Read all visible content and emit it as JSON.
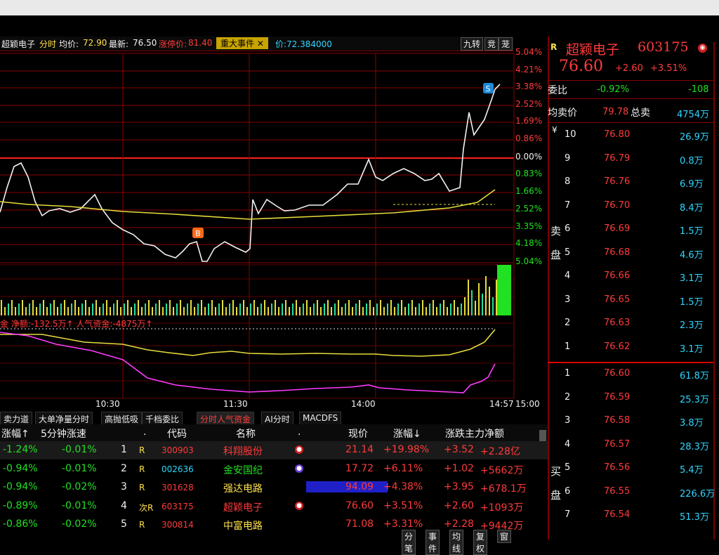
{
  "header": {
    "stock": "超颖电子",
    "mode": "分时",
    "avg_label": "均价:",
    "avg_value": "72.90",
    "latest_label": "最新:",
    "latest_value": "76.50",
    "limit_label": "涨停价:",
    "limit_value": "81.40",
    "event_label": "重大事件",
    "extra": "价:72.384000",
    "buttons": [
      "九转",
      "竞",
      "茏"
    ]
  },
  "right_axis": [
    "5.04%",
    "4.21%",
    "3.38%",
    "2.52%",
    "1.69%",
    "0.86%",
    "0.00%",
    "0.83%",
    "1.66%",
    "2.52%",
    "3.35%",
    "4.18%",
    "5.04%"
  ],
  "fund_label": "金 净额:-132.5万↑ 人气资金:-4875万↑",
  "time_axis": [
    "10:30",
    "11:30",
    "14:00",
    "14:57",
    "15:00"
  ],
  "markers": {
    "buy": "B",
    "sell": "S"
  },
  "quote": {
    "marker": "R",
    "name": "超颖电子",
    "code": "603175",
    "price": "76.60",
    "change": "+2.60",
    "pct": "+3.51%",
    "weibi_label": "委比",
    "weibi_value": "-0.92%",
    "weibi_diff": "-108",
    "avgsell_label": "均卖价",
    "avgsell_value": "79.78",
    "total_sell_label": "总卖",
    "total_sell_value": "4754万"
  },
  "orderbook": {
    "sell_side_label": [
      "卖",
      "盘"
    ],
    "buy_side_label": [
      "买",
      "盘"
    ],
    "yen": "¥",
    "asks": [
      {
        "level": "10",
        "price": "76.80",
        "vol": "26.9万"
      },
      {
        "level": "9",
        "price": "76.79",
        "vol": "0.8万"
      },
      {
        "level": "8",
        "price": "76.76",
        "vol": "6.9万"
      },
      {
        "level": "7",
        "price": "76.70",
        "vol": "8.4万"
      },
      {
        "level": "6",
        "price": "76.69",
        "vol": "1.5万"
      },
      {
        "level": "5",
        "price": "76.68",
        "vol": "4.6万"
      },
      {
        "level": "4",
        "price": "76.66",
        "vol": "3.1万"
      },
      {
        "level": "3",
        "price": "76.65",
        "vol": "1.5万"
      },
      {
        "level": "2",
        "price": "76.63",
        "vol": "2.3万"
      },
      {
        "level": "1",
        "price": "76.62",
        "vol": "3.1万"
      }
    ],
    "bids": [
      {
        "level": "1",
        "price": "76.60",
        "vol": "61.8万"
      },
      {
        "level": "2",
        "price": "76.59",
        "vol": "25.3万"
      },
      {
        "level": "3",
        "price": "76.58",
        "vol": "3.8万"
      },
      {
        "level": "4",
        "price": "76.57",
        "vol": "28.3万"
      },
      {
        "level": "5",
        "price": "76.56",
        "vol": "5.4万"
      },
      {
        "level": "6",
        "price": "76.55",
        "vol": "226.6万"
      },
      {
        "level": "7",
        "price": "76.54",
        "vol": "51.3万"
      }
    ]
  },
  "tabs": [
    "卖力道",
    "大单净量分时",
    "高抛低吸",
    "千档委比",
    "分时人气资金",
    "AI分时",
    "MACDFS"
  ],
  "active_tab": "分时人气资金",
  "table": {
    "left_headers": [
      "涨幅↑",
      "5分钟涨速"
    ],
    "headers": [
      ".",
      "代码",
      "名称",
      ".",
      "现价",
      "涨幅↓",
      "涨跌主力净额"
    ],
    "rows": [
      {
        "lpct": "-1.24%",
        "lspeed": "-0.01%",
        "idx": "1",
        "tag": "R",
        "code": "300903",
        "name": "科翔股份",
        "price": "21.14",
        "pct": "+19.98%",
        "chg": "+3.52",
        "net": "+2.28亿"
      },
      {
        "lpct": "-0.94%",
        "lspeed": "-0.01%",
        "idx": "2",
        "tag": "R",
        "code": "002636",
        "name": "金安国纪",
        "price": "17.72",
        "pct": "+6.11%",
        "chg": "+1.02",
        "net": "+5662万"
      },
      {
        "lpct": "-0.94%",
        "lspeed": "-0.02%",
        "idx": "3",
        "tag": "R",
        "code": "301628",
        "name": "强达电路",
        "price": "94.09",
        "pct": "+4.38%",
        "chg": "+3.95",
        "net": "+678.1万"
      },
      {
        "lpct": "-0.89%",
        "lspeed": "-0.01%",
        "idx": "4",
        "tag": "次R",
        "code": "603175",
        "name": "超颖电子",
        "price": "76.60",
        "pct": "+3.51%",
        "chg": "+2.60",
        "net": "+1093万"
      },
      {
        "lpct": "-0.86%",
        "lspeed": "-0.02%",
        "idx": "5",
        "tag": "R",
        "code": "300814",
        "name": "中富电路",
        "price": "71.08",
        "pct": "+3.31%",
        "chg": "+2.28",
        "net": "+9442万"
      }
    ]
  },
  "bottom_tabs": [
    "分笔",
    "事件",
    "均线",
    "复权",
    "窗"
  ],
  "colors": {
    "up": "#ff3b3b",
    "down": "#22e022",
    "avg": "#e6dc3c",
    "fund": "#ff3bff",
    "grid": "#8a0000"
  }
}
